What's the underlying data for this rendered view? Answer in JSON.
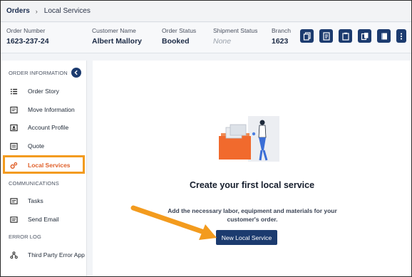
{
  "breadcrumb": {
    "root": "Orders",
    "separator": "›",
    "current": "Local Services"
  },
  "order": {
    "number_label": "Order Number",
    "number": "1623-237-24",
    "customer_label": "Customer Name",
    "customer": "Albert Mallory",
    "status_label": "Order Status",
    "status": "Booked",
    "shipment_label": "Shipment Status",
    "shipment": "None",
    "branch_label": "Branch",
    "branch": "1623"
  },
  "toolbar_icons": [
    "copy-icon",
    "document-icon",
    "clipboard-icon",
    "duplicate-icon",
    "notes-icon",
    "more-vertical-icon"
  ],
  "sidebar": {
    "section_order": "ORDER INFORMATION",
    "section_comms": "COMMUNICATIONS",
    "section_errors": "ERROR LOG",
    "items": [
      {
        "label": "Order Story",
        "icon": "list-icon"
      },
      {
        "label": "Move Information",
        "icon": "move-info-icon"
      },
      {
        "label": "Account Profile",
        "icon": "account-icon"
      },
      {
        "label": "Quote",
        "icon": "quote-icon"
      },
      {
        "label": "Local Services",
        "icon": "gears-icon",
        "active": true
      },
      {
        "label": "Tasks",
        "icon": "tasks-icon"
      },
      {
        "label": "Send Email",
        "icon": "email-icon"
      },
      {
        "label": "Third Party Error App",
        "icon": "network-icon"
      }
    ]
  },
  "main": {
    "empty_title": "Create your first local service",
    "empty_desc": "Add the necessary labor, equipment and materials for your customer's order.",
    "cta_label": "New Local Service"
  },
  "colors": {
    "navy": "#1c3b6f",
    "accent": "#e0602a",
    "highlight": "#f39b1e"
  }
}
